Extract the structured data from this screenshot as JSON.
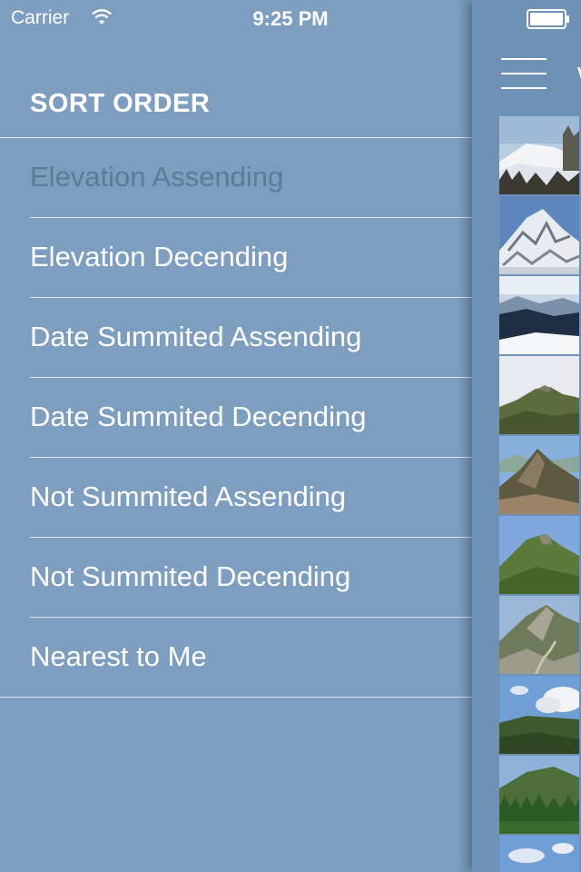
{
  "status_bar": {
    "carrier": "Carrier",
    "time": "9:25 PM",
    "wifi_icon": "wifi-icon",
    "battery_icon": "battery-icon"
  },
  "menu": {
    "header": "SORT ORDER",
    "items": [
      {
        "label": "Elevation Assending",
        "selected": true
      },
      {
        "label": "Elevation Decending",
        "selected": false
      },
      {
        "label": "Date Summited Assending",
        "selected": false
      },
      {
        "label": "Date Summited Decending",
        "selected": false
      },
      {
        "label": "Not Summited Assending",
        "selected": false
      },
      {
        "label": "Not Summited Decending",
        "selected": false
      },
      {
        "label": "Nearest to Me",
        "selected": false
      }
    ]
  },
  "main": {
    "menu_icon": "hamburger-menu-icon",
    "title_peek": "W",
    "thumbnails": [
      "mountain-photo-1",
      "mountain-photo-2",
      "mountain-photo-3",
      "mountain-photo-4",
      "mountain-photo-5",
      "mountain-photo-6",
      "mountain-photo-7",
      "mountain-photo-8",
      "mountain-photo-9",
      "mountain-photo-10"
    ]
  },
  "colors": {
    "menu_background": "#7d9ebf",
    "panel_background": "#6f91b5",
    "selected_text": "#5e7a98",
    "text": "#ffffff"
  }
}
